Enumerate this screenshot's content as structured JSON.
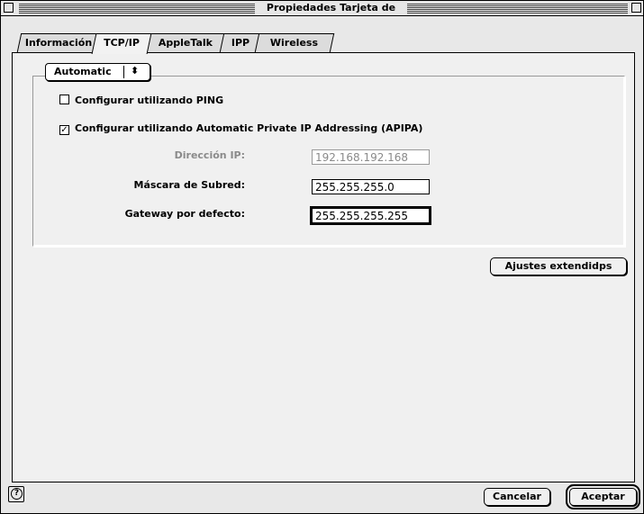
{
  "window": {
    "title": "Propiedades Tarjeta de Red"
  },
  "tabs": [
    {
      "label": "Información"
    },
    {
      "label": "TCP/IP",
      "active": true
    },
    {
      "label": "AppleTalk"
    },
    {
      "label": "IPP"
    },
    {
      "label": "Wireless"
    }
  ],
  "config": {
    "method_selected": "Automatic",
    "ping_label": "Configurar utilizando PING",
    "ping_checked": false,
    "apipa_label": "Configurar utilizando Automatic Private IP Addressing (APIPA)",
    "apipa_checked": true
  },
  "fields": {
    "ip_label": "Dirección IP:",
    "ip_value": "192.168.192.168",
    "mask_label": "Máscara de Subred:",
    "mask_value": "255.255.255.0",
    "gateway_label": "Gateway por defecto:",
    "gateway_value": "255.255.255.255"
  },
  "buttons": {
    "advanced": "Ajustes extendidps",
    "cancel": "Cancelar",
    "accept": "Aceptar"
  },
  "icons": {
    "help": "help-icon",
    "popup_arrows": "updown-arrows-icon",
    "check": "checkmark-icon"
  }
}
